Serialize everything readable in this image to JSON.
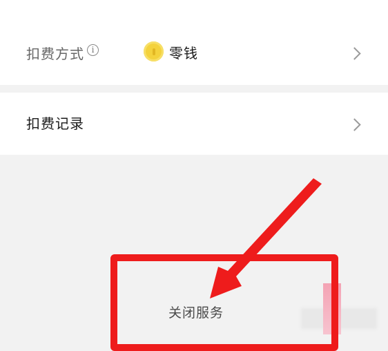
{
  "settings": {
    "payment_method_label": "扣费方式",
    "payment_method_value": "零钱",
    "records_label": "扣费记录"
  },
  "actions": {
    "close_service_label": "关闭服务"
  },
  "colors": {
    "annotation": "#ee1c1c",
    "coin": "#f4d23c"
  },
  "icons": [
    "info-icon",
    "coin-icon",
    "chevron-right-icon",
    "annotation-arrow"
  ]
}
